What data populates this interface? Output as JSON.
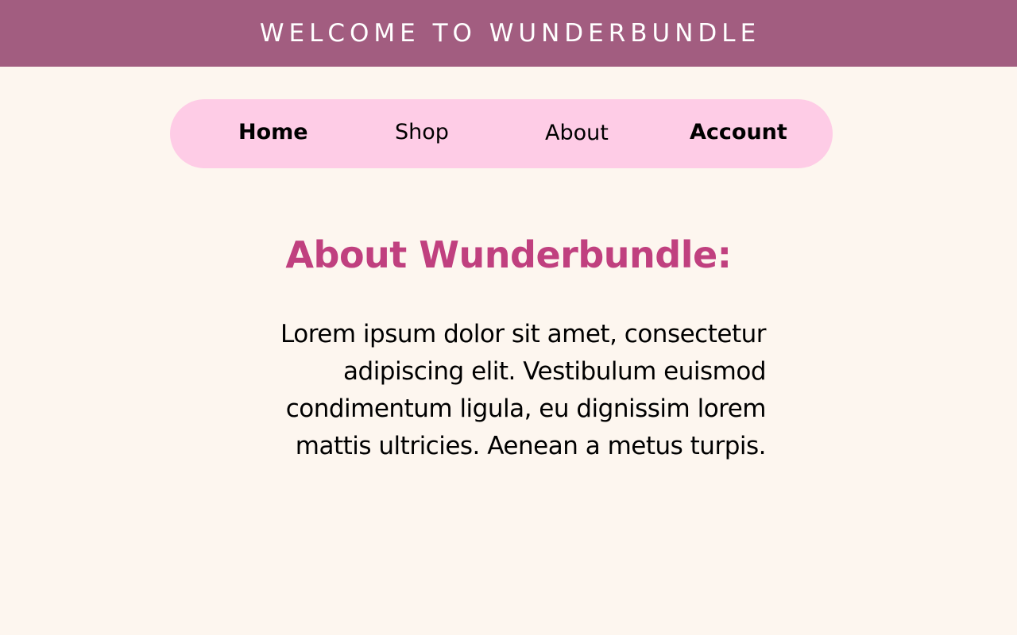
{
  "header": {
    "title": "WELCOME TO WUNDERBUNDLE"
  },
  "nav": {
    "items": [
      {
        "label": "Home"
      },
      {
        "label": "Shop"
      },
      {
        "label": "About"
      },
      {
        "label": "Account"
      }
    ]
  },
  "main": {
    "heading": "About Wunderbundle:",
    "body": "Lorem ipsum dolor sit amet, consectetur adipiscing elit. Vestibulum euismod condimentum ligula, eu dignissim lorem mattis ultricies. Aenean a metus turpis."
  },
  "colors": {
    "banner": "#a25d80",
    "nav_background": "#fecce6",
    "page_background": "#fdf6ef",
    "heading": "#c0407f"
  }
}
